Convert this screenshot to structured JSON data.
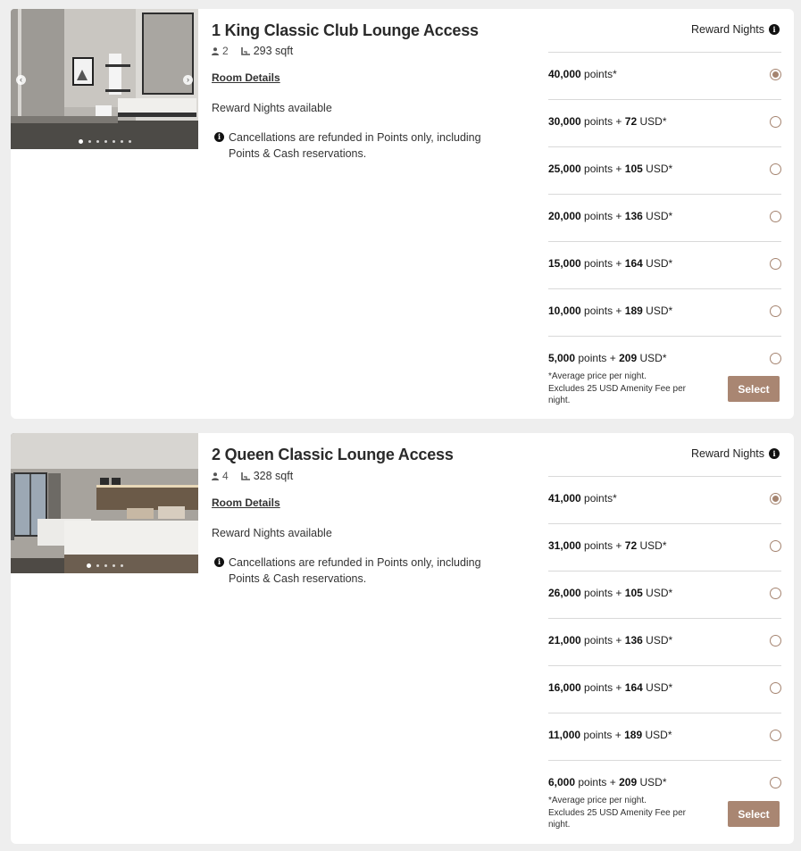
{
  "colors": {
    "accent": "#a98672",
    "radio": "#a58470",
    "background": "#eeeeee"
  },
  "rooms": [
    {
      "title": "1 King Classic Club Lounge Access",
      "occupancy": "2",
      "area": "293 sqft",
      "details_link": "Room Details",
      "availability": "Reward Nights available",
      "cancellation": "Cancellations are refunded in Points only, including Points & Cash reservations.",
      "reward_header": "Reward Nights",
      "rates": [
        {
          "points": "40,000",
          "points_label": "points*",
          "plus": "",
          "cash": "",
          "cash_label": "",
          "selected": true
        },
        {
          "points": "30,000",
          "points_label": "points",
          "plus": "+",
          "cash": "72",
          "cash_label": "USD*",
          "selected": false
        },
        {
          "points": "25,000",
          "points_label": "points",
          "plus": "+",
          "cash": "105",
          "cash_label": "USD*",
          "selected": false
        },
        {
          "points": "20,000",
          "points_label": "points",
          "plus": "+",
          "cash": "136",
          "cash_label": "USD*",
          "selected": false
        },
        {
          "points": "15,000",
          "points_label": "points",
          "plus": "+",
          "cash": "164",
          "cash_label": "USD*",
          "selected": false
        },
        {
          "points": "10,000",
          "points_label": "points",
          "plus": "+",
          "cash": "189",
          "cash_label": "USD*",
          "selected": false
        },
        {
          "points": "5,000",
          "points_label": "points",
          "plus": "+",
          "cash": "209",
          "cash_label": "USD*",
          "selected": false
        }
      ],
      "footnote_line1": "*Average price per night.",
      "footnote_line2": "Excludes 25 USD Amenity Fee per night.",
      "select_label": "Select"
    },
    {
      "title": "2 Queen Classic Lounge Access",
      "occupancy": "4",
      "area": "328 sqft",
      "details_link": "Room Details",
      "availability": "Reward Nights available",
      "cancellation": "Cancellations are refunded in Points only, including Points & Cash reservations.",
      "reward_header": "Reward Nights",
      "rates": [
        {
          "points": "41,000",
          "points_label": "points*",
          "plus": "",
          "cash": "",
          "cash_label": "",
          "selected": true
        },
        {
          "points": "31,000",
          "points_label": "points",
          "plus": "+",
          "cash": "72",
          "cash_label": "USD*",
          "selected": false
        },
        {
          "points": "26,000",
          "points_label": "points",
          "plus": "+",
          "cash": "105",
          "cash_label": "USD*",
          "selected": false
        },
        {
          "points": "21,000",
          "points_label": "points",
          "plus": "+",
          "cash": "136",
          "cash_label": "USD*",
          "selected": false
        },
        {
          "points": "16,000",
          "points_label": "points",
          "plus": "+",
          "cash": "164",
          "cash_label": "USD*",
          "selected": false
        },
        {
          "points": "11,000",
          "points_label": "points",
          "plus": "+",
          "cash": "189",
          "cash_label": "USD*",
          "selected": false
        },
        {
          "points": "6,000",
          "points_label": "points",
          "plus": "+",
          "cash": "209",
          "cash_label": "USD*",
          "selected": false
        }
      ],
      "footnote_line1": "*Average price per night.",
      "footnote_line2": "Excludes 25 USD Amenity Fee per night.",
      "select_label": "Select"
    }
  ]
}
